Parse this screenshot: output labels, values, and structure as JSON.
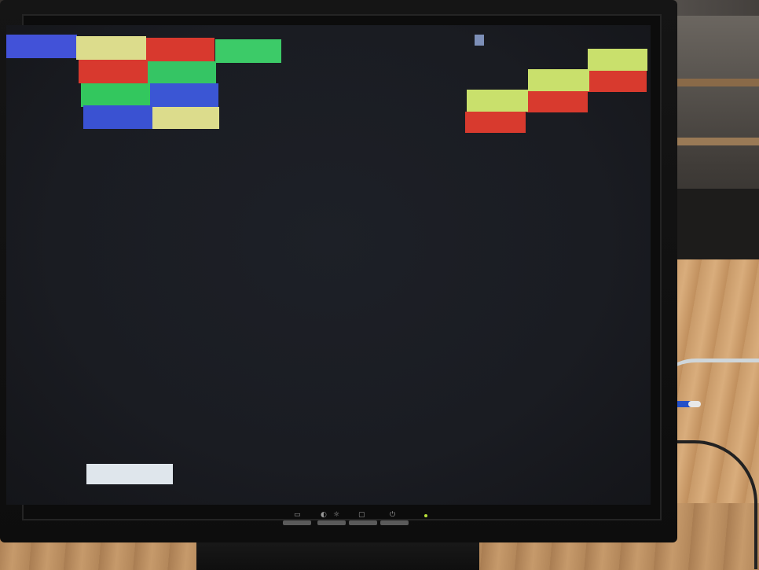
{
  "scene": {
    "description_colors": {
      "screen_bg": "#1b1d23",
      "blue": "#3f4fd6",
      "yellow": "#d9dc86",
      "red": "#d8382c",
      "green": "#33c95e",
      "lime": "#c8e06a",
      "paddle": "#dfe6ec"
    }
  },
  "game": {
    "bricks_left": [
      {
        "color": "#4252d8"
      },
      {
        "color": "#dcdc8c"
      },
      {
        "color": "#d8392e"
      },
      {
        "color": "#3ccb68"
      },
      {
        "color": "#d8392e"
      },
      {
        "color": "#35c564"
      },
      {
        "color": "#33c75e"
      },
      {
        "color": "#3b56d4"
      },
      {
        "color": "#3a52d2"
      },
      {
        "color": "#dcdc8c"
      }
    ],
    "bricks_right": [
      {
        "color": "#c9e06c"
      },
      {
        "color": "#d83a2e"
      },
      {
        "color": "#c9e06c"
      },
      {
        "color": "#d83a2e"
      },
      {
        "color": "#c9e06c"
      },
      {
        "color": "#d83a2e"
      }
    ],
    "paddle_color": "#dfe6ec",
    "ball_color": "#7d8fb8"
  },
  "monitor_controls": {
    "icons": [
      "menu-icon",
      "contrast-icon",
      "brightness-icon",
      "input-source-icon",
      "power-icon"
    ]
  }
}
